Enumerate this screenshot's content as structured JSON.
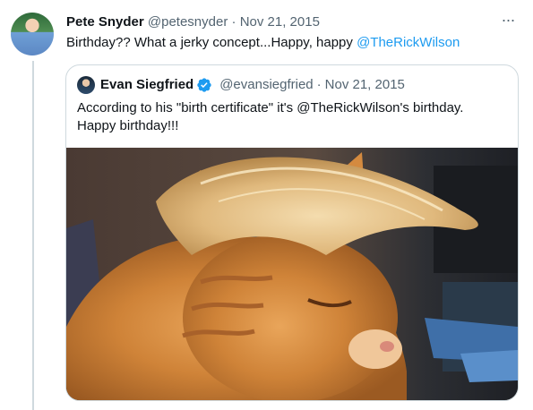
{
  "tweet": {
    "display_name": "Pete Snyder",
    "handle": "@petesnyder",
    "separator": "·",
    "date": "Nov 21, 2015",
    "more_label": "···",
    "text_prefix": "Birthday?? What a jerky concept...Happy, happy ",
    "text_mention": "@TheRickWilson"
  },
  "quote": {
    "display_name": "Evan Siegfried",
    "handle": "@evansiegfried",
    "separator": "·",
    "date": "Nov 21, 2015",
    "text_line1": "According to his \"birth certificate\" it's @TheRickWilson's birthday.",
    "text_line2": "Happy birthday!!!",
    "verified_icon": "verified-badge-icon",
    "media_icon": "cat-photo"
  },
  "colors": {
    "link": "#1d9bf0",
    "secondary": "#536471",
    "border": "#cfd9de",
    "text": "#0f1419"
  }
}
